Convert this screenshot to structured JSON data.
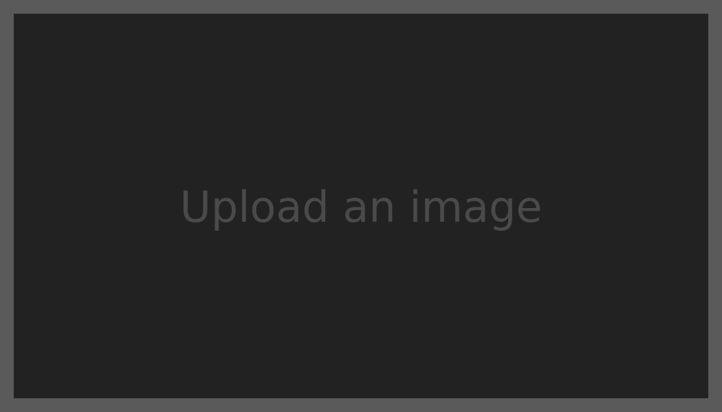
{
  "upload_area": {
    "prompt_text": "Upload an image"
  },
  "colors": {
    "outer_border": "#5a5a5a",
    "panel_background": "#222222",
    "prompt_text": "#4a4a4a"
  }
}
